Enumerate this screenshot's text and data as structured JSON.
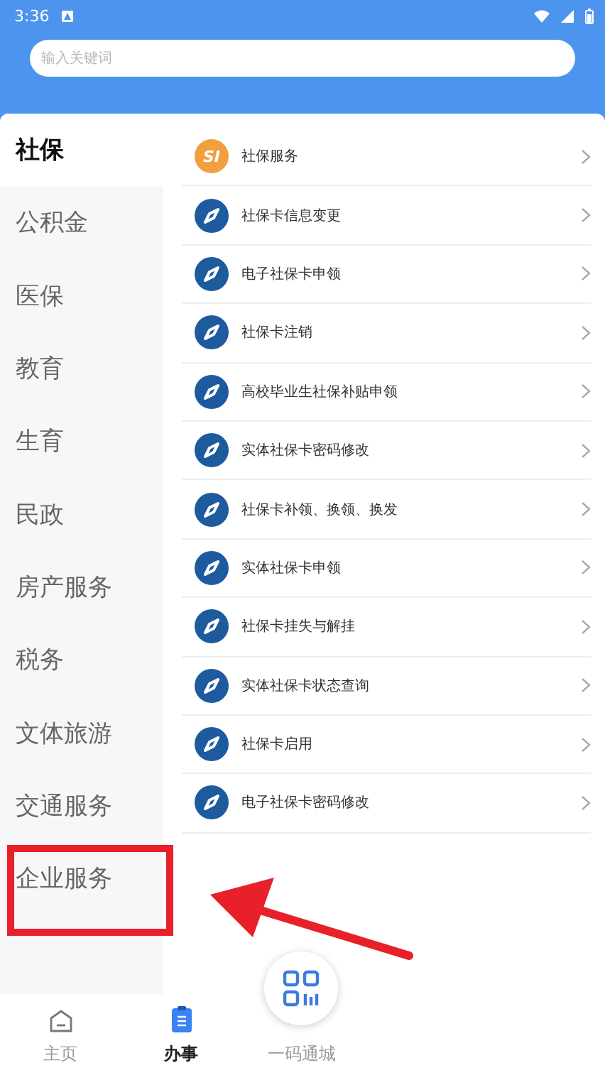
{
  "status_bar": {
    "time": "3:36"
  },
  "search": {
    "placeholder": "输入关键词"
  },
  "sidebar": {
    "items": [
      {
        "label": "社保",
        "selected": true
      },
      {
        "label": "公积金",
        "selected": false
      },
      {
        "label": "医保",
        "selected": false
      },
      {
        "label": "教育",
        "selected": false
      },
      {
        "label": "生育",
        "selected": false
      },
      {
        "label": "民政",
        "selected": false
      },
      {
        "label": "房产服务",
        "selected": false
      },
      {
        "label": "税务",
        "selected": false
      },
      {
        "label": "文体旅游",
        "selected": false
      },
      {
        "label": "交通服务",
        "selected": false
      },
      {
        "label": "企业服务",
        "selected": false
      }
    ]
  },
  "services": [
    {
      "kind": "badge",
      "badge": "SI",
      "label": "社保服务"
    },
    {
      "kind": "compass",
      "label": "社保卡信息变更"
    },
    {
      "kind": "compass",
      "label": "电子社保卡申领"
    },
    {
      "kind": "compass",
      "label": "社保卡注销"
    },
    {
      "kind": "compass",
      "label": "高校毕业生社保补贴申领"
    },
    {
      "kind": "compass",
      "label": "实体社保卡密码修改"
    },
    {
      "kind": "compass",
      "label": "社保卡补领、换领、换发"
    },
    {
      "kind": "compass",
      "label": "实体社保卡申领"
    },
    {
      "kind": "compass",
      "label": "社保卡挂失与解挂"
    },
    {
      "kind": "compass",
      "label": "实体社保卡状态查询"
    },
    {
      "kind": "compass",
      "label": "社保卡启用"
    },
    {
      "kind": "compass",
      "label": "电子社保卡密码修改"
    }
  ],
  "bottom_nav": [
    {
      "kind": "home",
      "label": "主页",
      "selected": false
    },
    {
      "kind": "tasks",
      "label": "办事",
      "selected": true
    },
    {
      "kind": "qr",
      "label": "一码通城",
      "selected": false
    }
  ]
}
